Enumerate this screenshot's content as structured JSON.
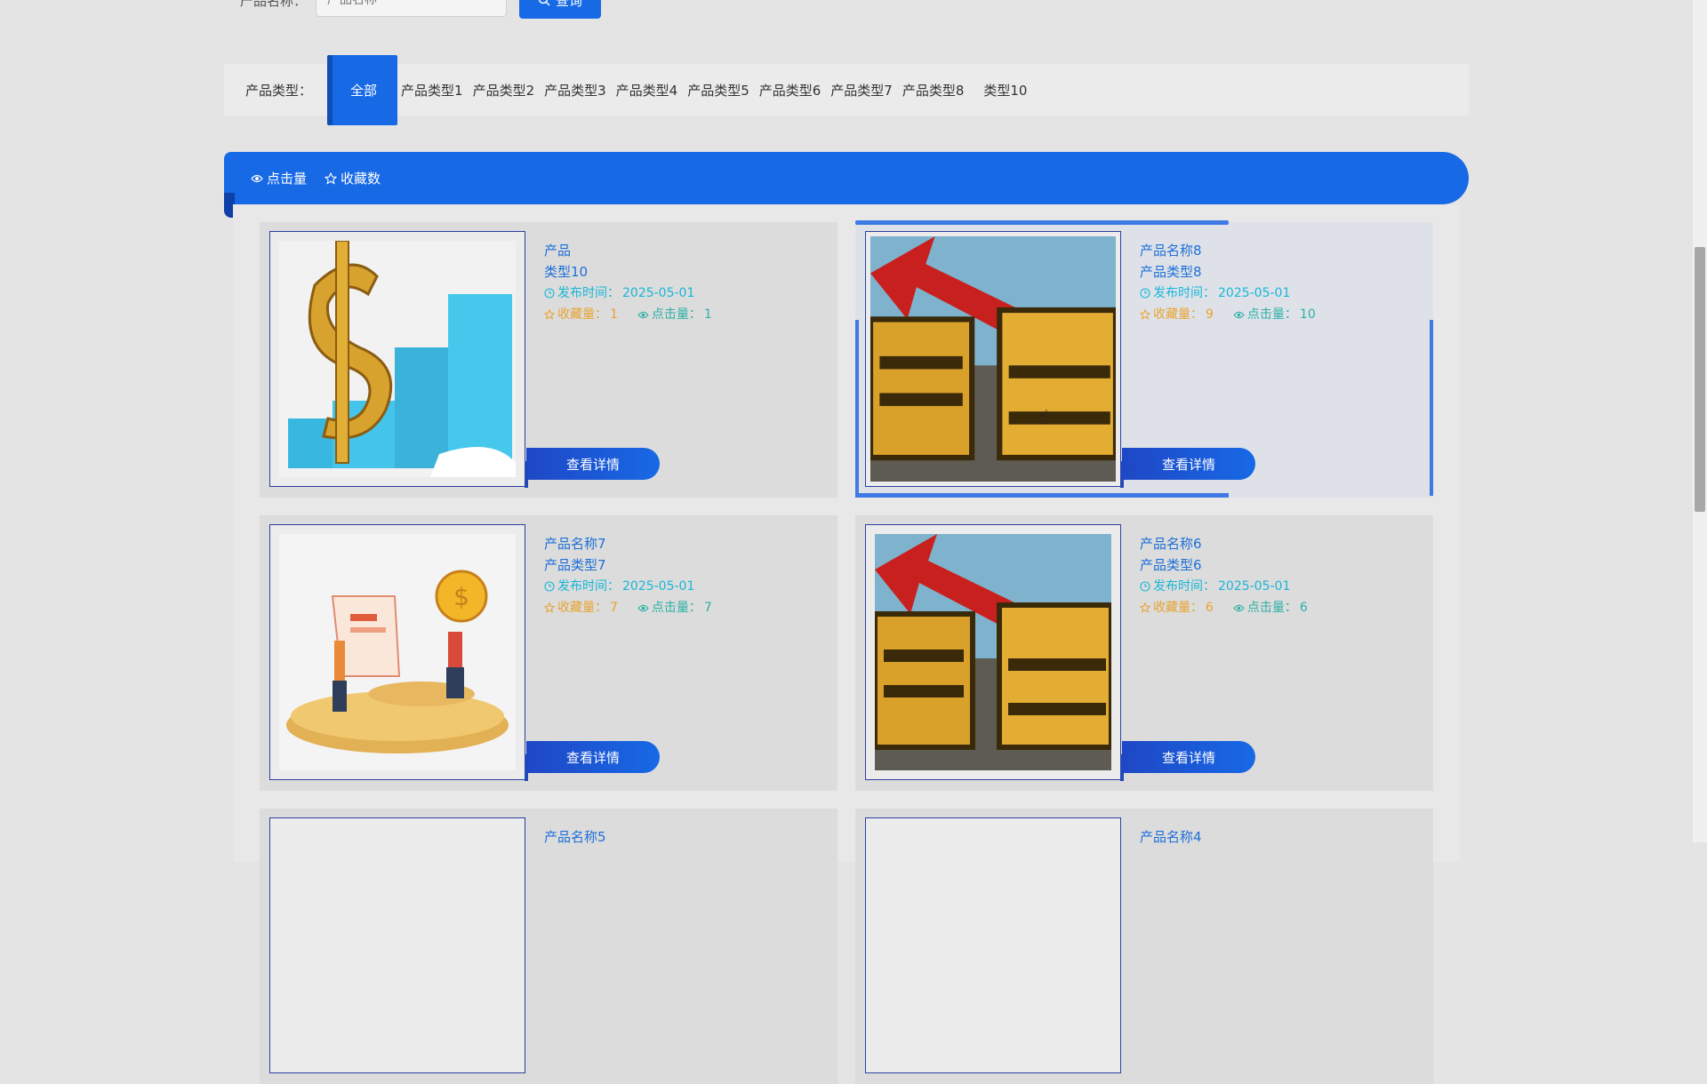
{
  "search": {
    "label": "产品名称：",
    "placeholder": "产品名称",
    "button_label": "查询"
  },
  "type_filter": {
    "label": "产品类型：",
    "selected": "全部",
    "items": [
      "产品类型1",
      "产品类型2",
      "产品类型3",
      "产品类型4",
      "产品类型5",
      "产品类型6",
      "产品类型7",
      "产品类型8",
      "类型10"
    ]
  },
  "sort": {
    "clicks_label": "点击量",
    "favorites_label": "收藏数"
  },
  "cards": [
    {
      "title": "产品",
      "type": "类型10",
      "date_label": "发布时间：",
      "date": "2025-05-01",
      "fav_label": "收藏量：",
      "fav": "1",
      "click_label": "点击量：",
      "clicks": "1",
      "button": "查看详情",
      "image": "dollar-chart-image"
    },
    {
      "title": "产品名称8",
      "type": "产品类型8",
      "date_label": "发布时间：",
      "date": "2025-05-01",
      "fav_label": "收藏量：",
      "fav": "9",
      "click_label": "点击量：",
      "clicks": "10",
      "button": "查看详情",
      "image": "fund-image"
    },
    {
      "title": "产品名称7",
      "type": "产品类型7",
      "date_label": "发布时间：",
      "date": "2025-05-01",
      "fav_label": "收藏量：",
      "fav": "7",
      "click_label": "点击量：",
      "clicks": "7",
      "button": "查看详情",
      "image": "coin-people-image"
    },
    {
      "title": "产品名称6",
      "type": "产品类型6",
      "date_label": "发布时间：",
      "date": "2025-05-01",
      "fav_label": "收藏量：",
      "fav": "6",
      "click_label": "点击量：",
      "clicks": "6",
      "button": "查看详情",
      "image": "fund-image"
    },
    {
      "title": "产品名称5"
    },
    {
      "title": "产品名称4"
    }
  ],
  "colors": {
    "accent": "#1769e6",
    "title": "#1d6fd8",
    "date": "#18b6d8",
    "fav": "#e8a32d",
    "clicks": "#2cb0a6"
  }
}
